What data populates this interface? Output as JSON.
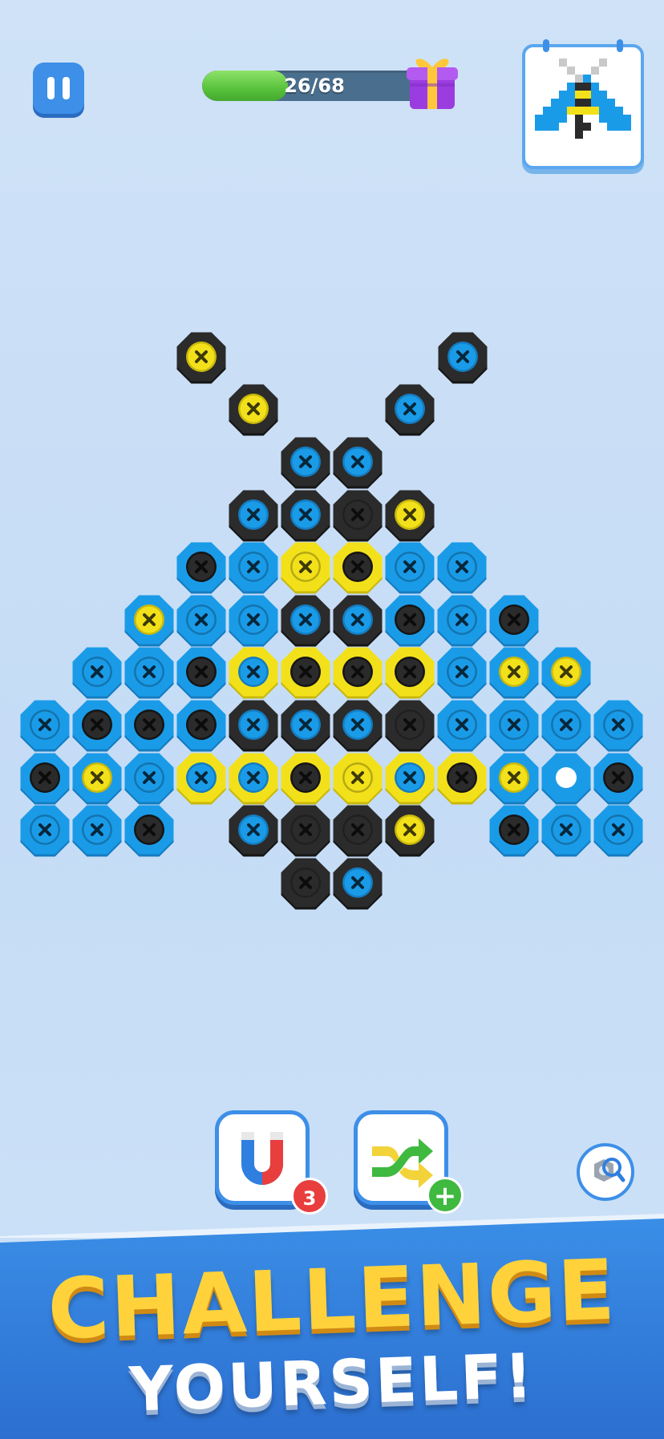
{
  "hud": {
    "pause_icon": "pause-icon",
    "progress": {
      "current": 26,
      "total": 68,
      "label": "26/68",
      "fill_color": "#58c23c"
    },
    "reward_icon": "gift-icon",
    "preview_icon": "pixel-art-moth-preview"
  },
  "colors": {
    "blue": "#1a9be8",
    "black": "#2b2b2b",
    "yellow": "#f2e11a",
    "accent": "#3d8fe8"
  },
  "board": {
    "hex_rows": [
      "...K.........K",
      "....K.......K.",
      ".....KK.....",
      ".....KKKK....",
      "...BBYYBB....",
      "..BBBKKBBB...",
      ".BBBYYYYBBB..",
      "BBBBKKKKBBBB",
      "BBBYYYYYYYBB",
      "BBB.KKKK.BBB",
      ".....KK....."
    ],
    "screws": [
      {
        "hex": "black",
        "screw": "yellow"
      },
      {
        "hex": "black",
        "screw": "blue"
      },
      {
        "hex": "black",
        "screw": "yellow"
      },
      {
        "hex": "black",
        "screw": "blue"
      },
      {
        "hex": "black",
        "screw": "blue"
      },
      {
        "hex": "black",
        "screw": "blue"
      },
      {
        "hex": "black",
        "screw": "blue"
      },
      {
        "hex": "black",
        "screw": "blue"
      },
      {
        "hex": "black",
        "screw": "black"
      },
      {
        "hex": "black",
        "screw": "yellow"
      },
      {
        "hex": "blue",
        "screw": "black"
      },
      {
        "hex": "blue",
        "screw": "blue"
      },
      {
        "hex": "yellow",
        "screw": "yellow"
      },
      {
        "hex": "yellow",
        "screw": "black"
      },
      {
        "hex": "blue",
        "screw": "blue"
      },
      {
        "hex": "blue",
        "screw": "blue"
      },
      {
        "hex": "blue",
        "screw": "yellow"
      },
      {
        "hex": "blue",
        "screw": "blue"
      },
      {
        "hex": "blue",
        "screw": "blue"
      },
      {
        "hex": "black",
        "screw": "blue"
      },
      {
        "hex": "black",
        "screw": "blue"
      },
      {
        "hex": "blue",
        "screw": "black"
      },
      {
        "hex": "blue",
        "screw": "blue"
      },
      {
        "hex": "blue",
        "screw": "black"
      },
      {
        "hex": "blue",
        "screw": "blue"
      },
      {
        "hex": "blue",
        "screw": "blue"
      },
      {
        "hex": "blue",
        "screw": "black"
      },
      {
        "hex": "yellow",
        "screw": "blue"
      },
      {
        "hex": "yellow",
        "screw": "black"
      },
      {
        "hex": "yellow",
        "screw": "black"
      },
      {
        "hex": "yellow",
        "screw": "black"
      },
      {
        "hex": "blue",
        "screw": "blue"
      },
      {
        "hex": "blue",
        "screw": "yellow"
      },
      {
        "hex": "blue",
        "screw": "yellow"
      },
      {
        "hex": "blue",
        "screw": "blue"
      },
      {
        "hex": "blue",
        "screw": "black"
      },
      {
        "hex": "blue",
        "screw": "black"
      },
      {
        "hex": "blue",
        "screw": "black"
      },
      {
        "hex": "black",
        "screw": "blue"
      },
      {
        "hex": "black",
        "screw": "blue"
      },
      {
        "hex": "black",
        "screw": "blue"
      },
      {
        "hex": "black",
        "screw": "black"
      },
      {
        "hex": "blue",
        "screw": "blue"
      },
      {
        "hex": "blue",
        "screw": "blue"
      },
      {
        "hex": "blue",
        "screw": "blue"
      },
      {
        "hex": "blue",
        "screw": "blue"
      },
      {
        "hex": "blue",
        "screw": "black"
      },
      {
        "hex": "blue",
        "screw": "yellow"
      },
      {
        "hex": "blue",
        "screw": "blue"
      },
      {
        "hex": "yellow",
        "screw": "blue"
      },
      {
        "hex": "yellow",
        "screw": "blue"
      },
      {
        "hex": "yellow",
        "screw": "black"
      },
      {
        "hex": "yellow",
        "screw": "yellow"
      },
      {
        "hex": "yellow",
        "screw": "blue"
      },
      {
        "hex": "yellow",
        "screw": "black"
      },
      {
        "hex": "blue",
        "screw": "yellow"
      },
      {
        "hex": "blue",
        "screw": "empty"
      },
      {
        "hex": "blue",
        "screw": "black"
      },
      {
        "hex": "blue",
        "screw": "blue"
      },
      {
        "hex": "blue",
        "screw": "blue"
      },
      {
        "hex": "blue",
        "screw": "black"
      },
      {
        "hex": "black",
        "screw": "blue"
      },
      {
        "hex": "black",
        "screw": "black"
      },
      {
        "hex": "black",
        "screw": "black"
      },
      {
        "hex": "black",
        "screw": "yellow"
      },
      {
        "hex": "blue",
        "screw": "black"
      },
      {
        "hex": "blue",
        "screw": "blue"
      },
      {
        "hex": "blue",
        "screw": "blue"
      },
      {
        "hex": "black",
        "screw": "black"
      },
      {
        "hex": "black",
        "screw": "blue"
      }
    ]
  },
  "boosters": {
    "magnet": {
      "icon": "magnet-icon",
      "count": "3"
    },
    "shuffle": {
      "icon": "shuffle-icon",
      "badge": "+"
    },
    "search": {
      "icon": "screw-search-icon"
    }
  },
  "banner": {
    "line1": "CHALLENGE",
    "line2": "YOURSELF!"
  }
}
